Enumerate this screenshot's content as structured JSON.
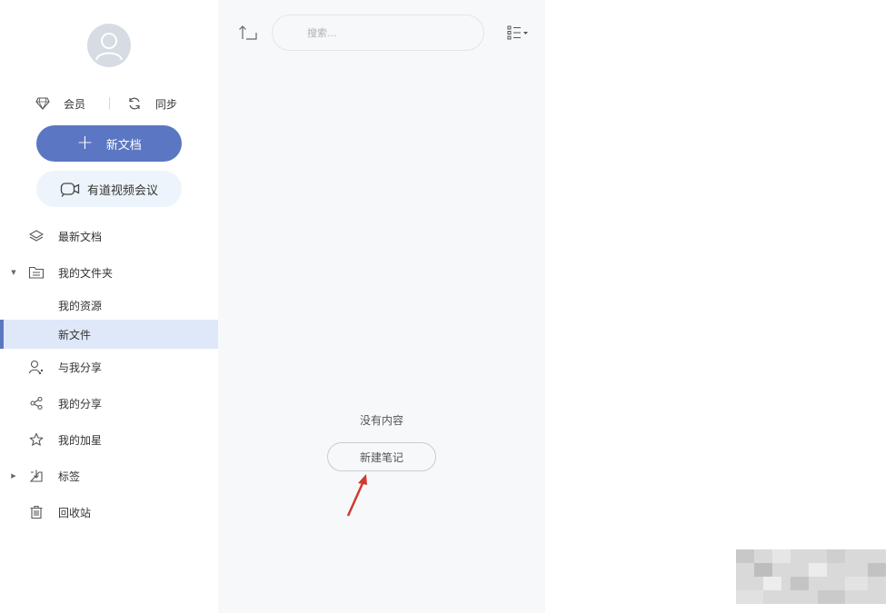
{
  "sidebar": {
    "member_label": "会员",
    "sync_label": "同步",
    "new_doc_label": "新文档",
    "meeting_label": "有道视频会议",
    "nav": {
      "latest": "最新文档",
      "folder": "我的文件夹",
      "resources": "我的资源",
      "new_file": "新文件",
      "shared_with_me": "与我分享",
      "my_shares": "我的分享",
      "starred": "我的加星",
      "tags": "标签",
      "trash": "回收站"
    }
  },
  "panel": {
    "search_placeholder": "搜索...",
    "empty_text": "没有内容",
    "new_note_label": "新建笔记"
  },
  "colors": {
    "accent": "#5b76c2",
    "active_bg": "#dfe8f8",
    "arrow": "#d03a2f"
  }
}
